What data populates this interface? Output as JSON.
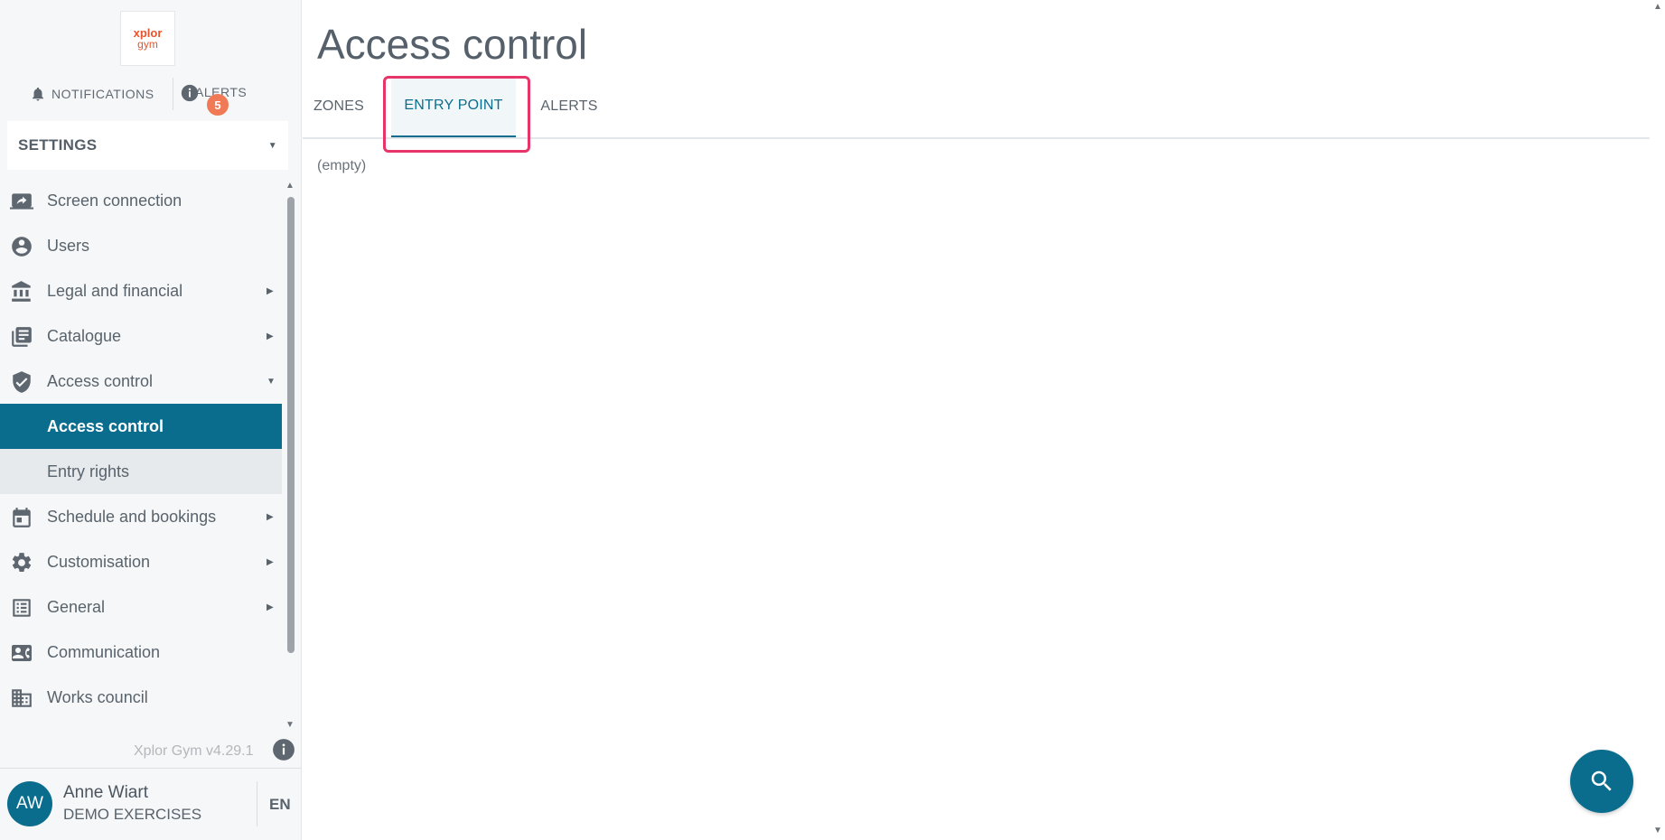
{
  "logo": {
    "line1": "xplor",
    "line2": "gym"
  },
  "topbar": {
    "notifications_label": "NOTIFICATIONS",
    "alerts_label": "ALERTS",
    "alerts_count": "5"
  },
  "settings": {
    "label": "SETTINGS"
  },
  "menu": {
    "items": [
      {
        "label": "Screen connection",
        "icon": "screen-share-icon"
      },
      {
        "label": "Users",
        "icon": "account-circle-icon"
      },
      {
        "label": "Legal and financial",
        "icon": "bank-icon"
      },
      {
        "label": "Catalogue",
        "icon": "library-books-icon"
      },
      {
        "label": "Access control",
        "icon": "verified-shield-icon"
      },
      {
        "label": "Access control"
      },
      {
        "label": "Entry rights"
      },
      {
        "label": "Schedule and bookings",
        "icon": "calendar-icon"
      },
      {
        "label": "Customisation",
        "icon": "gear-icon"
      },
      {
        "label": "General",
        "icon": "list-alt-icon"
      },
      {
        "label": "Communication",
        "icon": "contact-card-icon"
      },
      {
        "label": "Works council",
        "icon": "building-icon"
      }
    ]
  },
  "version": "Xplor Gym v4.29.1",
  "user": {
    "initials": "AW",
    "name": "Anne Wiart",
    "org": "DEMO EXERCISES",
    "lang": "EN"
  },
  "page": {
    "title": "Access control",
    "empty_text": "(empty)"
  },
  "tabs": [
    {
      "label": "ZONES"
    },
    {
      "label": "ENTRY POINT"
    },
    {
      "label": "ALERTS"
    }
  ],
  "colors": {
    "primary": "#0b6d8e",
    "badge": "#ef7a55",
    "highlight": "#e7356a"
  }
}
